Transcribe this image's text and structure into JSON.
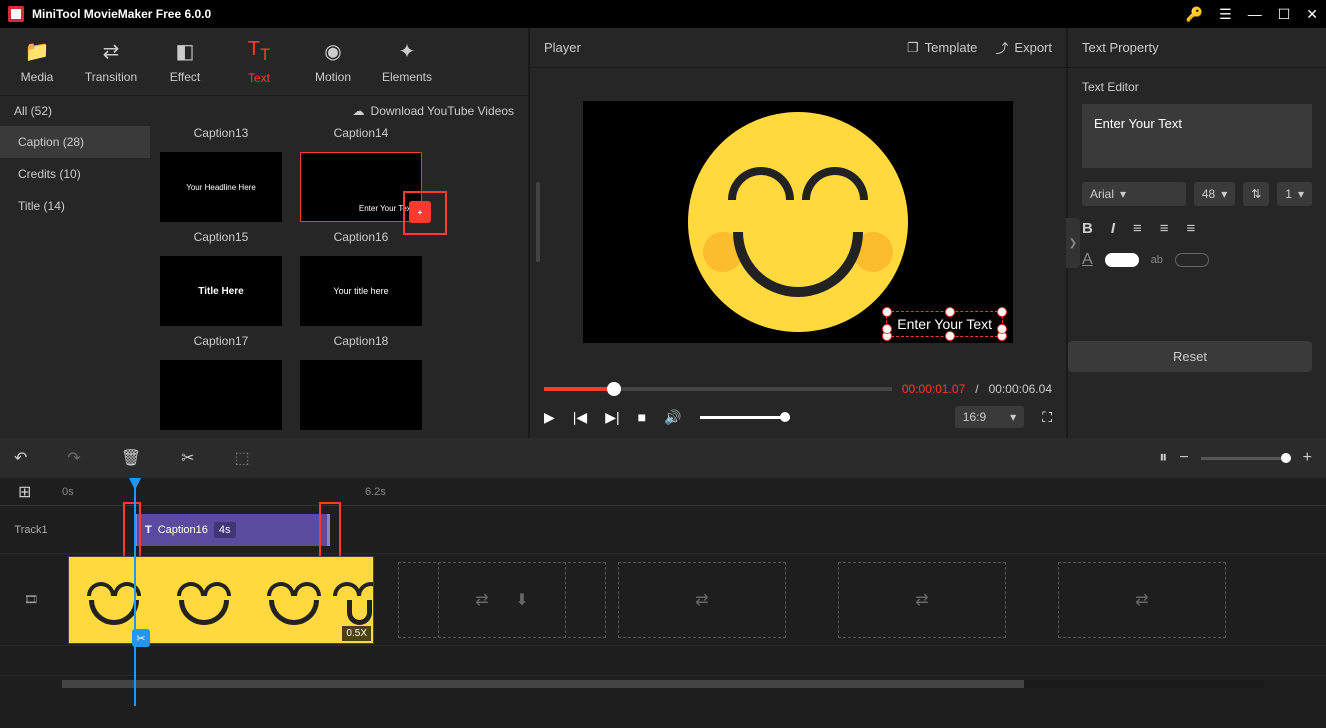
{
  "titlebar": {
    "app_title": "MiniTool MovieMaker Free 6.0.0"
  },
  "tool_tabs": {
    "media": "Media",
    "transition": "Transition",
    "effect": "Effect",
    "text": "Text",
    "motion": "Motion",
    "elements": "Elements"
  },
  "category_bar": {
    "all": "All (52)",
    "download": "Download YouTube Videos"
  },
  "categories": {
    "caption": "Caption (28)",
    "credits": "Credits (10)",
    "title": "Title (14)"
  },
  "thumbs": {
    "c13": "Caption13",
    "c14": "Caption14",
    "c15": "Caption15",
    "c16": "Caption16",
    "c17": "Caption17",
    "c18": "Caption18",
    "preview15": "Your Headline Here",
    "preview16": "Enter Your Text",
    "preview17": "Title Here",
    "preview18": "Your title here"
  },
  "player": {
    "title": "Player",
    "template": "Template",
    "export": "Export",
    "overlay_text": "Enter Your Text",
    "time_current": "00:00:01.07",
    "time_total": "00:00:06.04",
    "time_sep": " / ",
    "aspect": "16:9"
  },
  "text_panel": {
    "header": "Text Property",
    "editor_label": "Text Editor",
    "placeholder": "Enter Your Text",
    "font": "Arial",
    "size": "48",
    "line": "1",
    "reset": "Reset",
    "bold": "B",
    "italic": "I"
  },
  "timeline": {
    "ruler_start": "0s",
    "ruler_mid": "6.2s",
    "track1": "Track1",
    "clip_name": "Caption16",
    "clip_dur": "4s",
    "clip_text_icon": "T",
    "speed": "0.5X"
  }
}
